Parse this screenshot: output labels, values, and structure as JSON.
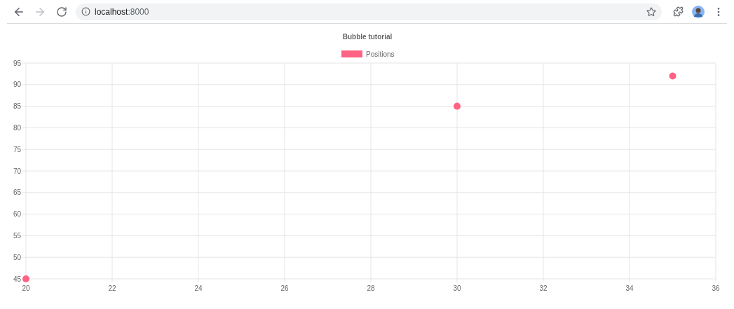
{
  "browser": {
    "url_host": "localhost",
    "url_port": ":8000"
  },
  "chart": {
    "chart_data": {
      "type": "scatter",
      "title": "Bubble tutorial",
      "series": [
        {
          "name": "Positions",
          "color": "#ff6384",
          "x": [
            20,
            30,
            35
          ],
          "values": [
            45,
            85,
            92
          ]
        }
      ],
      "xlim": [
        20,
        36
      ],
      "ylim": [
        45,
        95
      ],
      "xticks": [
        20,
        22,
        24,
        26,
        28,
        30,
        32,
        34,
        36
      ],
      "yticks": [
        45,
        50,
        55,
        60,
        65,
        70,
        75,
        80,
        85,
        90,
        95
      ],
      "grid": true
    }
  }
}
